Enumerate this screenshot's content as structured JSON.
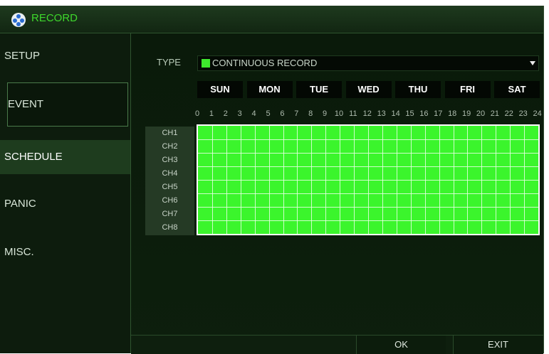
{
  "window": {
    "title": "RECORD",
    "icon": "camera-reel-icon"
  },
  "sidebar": {
    "items": [
      {
        "label": "SETUP"
      },
      {
        "label": "EVENT"
      },
      {
        "label": "SCHEDULE"
      },
      {
        "label": "PANIC"
      },
      {
        "label": "MISC."
      }
    ],
    "active": "SCHEDULE"
  },
  "schedule": {
    "type_label": "TYPE",
    "type_value": "CONTINUOUS RECORD",
    "type_color": "#3ee72d",
    "days": [
      "SUN",
      "MON",
      "TUE",
      "WED",
      "THU",
      "FRI",
      "SAT"
    ],
    "hours": [
      "0",
      "1",
      "2",
      "3",
      "4",
      "5",
      "6",
      "7",
      "8",
      "9",
      "10",
      "11",
      "12",
      "13",
      "14",
      "15",
      "16",
      "17",
      "18",
      "19",
      "20",
      "21",
      "22",
      "23",
      "24"
    ],
    "channels": [
      "CH1",
      "CH2",
      "CH3",
      "CH4",
      "CH5",
      "CH6",
      "CH7",
      "CH8"
    ],
    "grid_color": "#3bf52c"
  },
  "buttons": {
    "ok": "OK",
    "exit": "EXIT"
  }
}
